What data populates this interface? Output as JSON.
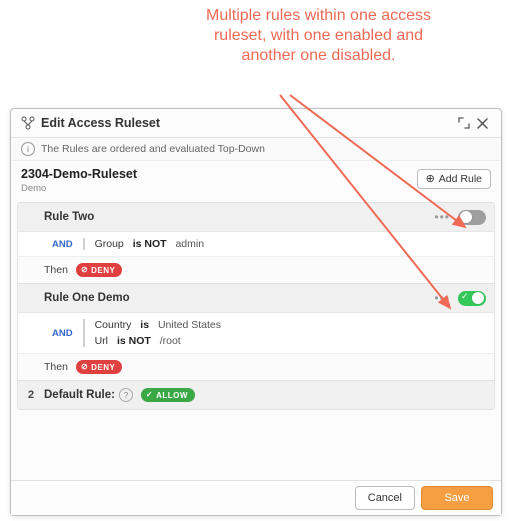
{
  "callout": "Multiple rules within one access ruleset, with one enabled and another one disabled.",
  "dialog": {
    "title": "Edit Access Ruleset",
    "info_text": "The Rules are ordered and evaluated Top-Down",
    "ruleset_name": "2304-Demo-Ruleset",
    "ruleset_sub": "Demo",
    "add_rule_label": "Add Rule"
  },
  "rules": [
    {
      "name": "Rule Two",
      "enabled": false,
      "logic": "AND",
      "conditions": [
        {
          "field": "Group",
          "op": "is NOT",
          "value": "admin"
        }
      ],
      "then_label": "Then",
      "action": {
        "type": "deny",
        "label": "DENY"
      }
    },
    {
      "name": "Rule One Demo",
      "enabled": true,
      "logic": "AND",
      "conditions": [
        {
          "field": "Country",
          "op": "is",
          "value": "United States"
        },
        {
          "field": "Url",
          "op": "is NOT",
          "value": "/root"
        }
      ],
      "then_label": "Then",
      "action": {
        "type": "deny",
        "label": "DENY"
      }
    }
  ],
  "default_rule": {
    "index": "2",
    "label": "Default Rule:",
    "action": {
      "type": "allow",
      "label": "ALLOW"
    }
  },
  "footer": {
    "cancel": "Cancel",
    "save": "Save"
  },
  "colors": {
    "callout": "#ee6a55",
    "deny": "#e04040",
    "allow": "#39a845",
    "toggle_on": "#34c759",
    "toggle_off": "#9e9e9e",
    "primary_btn": "#f59e42"
  }
}
